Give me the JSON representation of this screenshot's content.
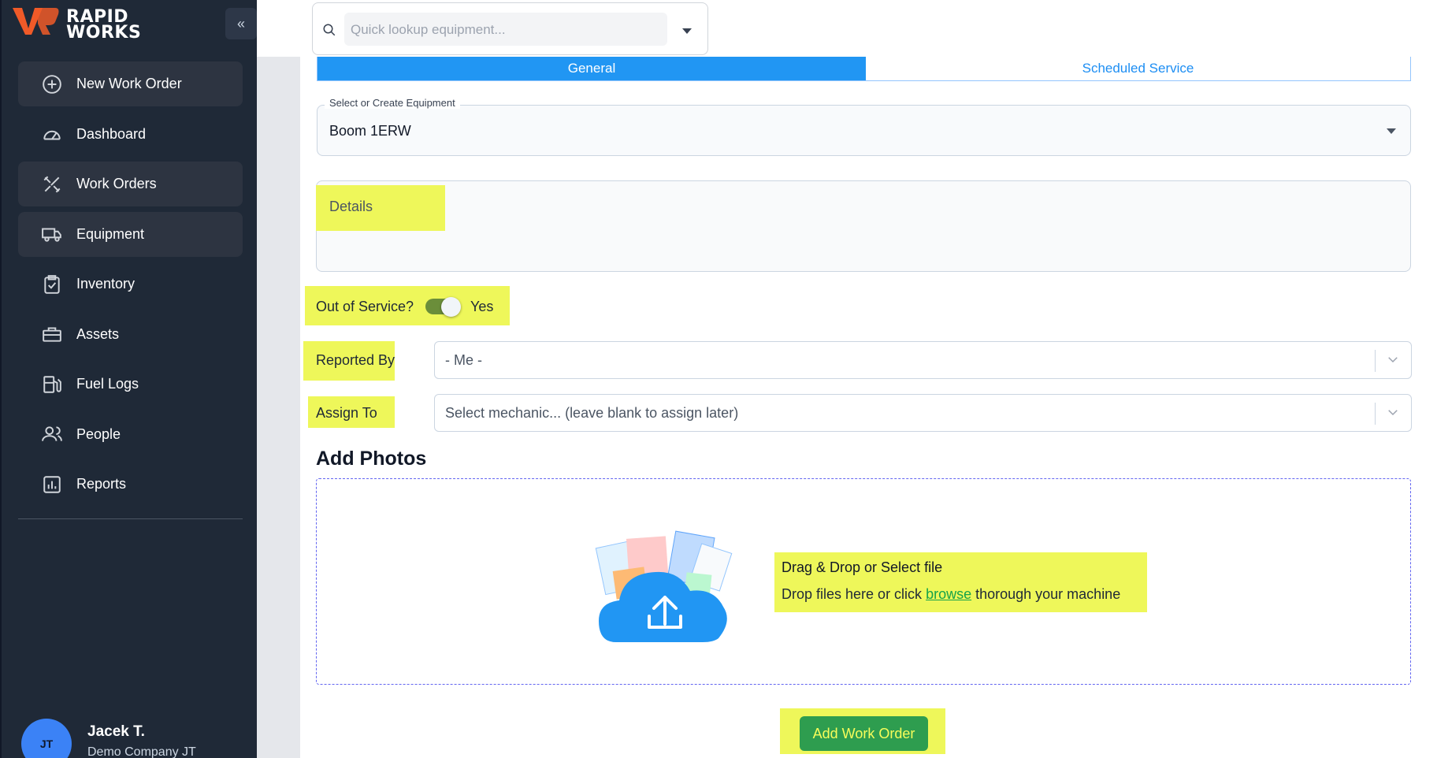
{
  "brand": {
    "line1": "RAPID",
    "line2": "WORKS",
    "accent": "#f05a28"
  },
  "sidebar": {
    "collapse_glyph": "«",
    "items": [
      {
        "label": "New Work Order",
        "icon": "plus-circle-icon",
        "active": true
      },
      {
        "label": "Dashboard",
        "icon": "gauge-icon",
        "active": false
      },
      {
        "label": "Work Orders",
        "icon": "tools-icon",
        "active": true
      },
      {
        "label": "Equipment",
        "icon": "truck-icon",
        "active": true
      },
      {
        "label": "Inventory",
        "icon": "clipboard-check-icon",
        "active": false
      },
      {
        "label": "Assets",
        "icon": "toolbox-icon",
        "active": false
      },
      {
        "label": "Fuel Logs",
        "icon": "fuel-pump-icon",
        "active": false
      },
      {
        "label": "People",
        "icon": "people-icon",
        "active": false
      },
      {
        "label": "Reports",
        "icon": "bar-chart-icon",
        "active": false
      }
    ],
    "user": {
      "initials": "JT",
      "name": "Jacek T.",
      "company": "Demo Company JT"
    }
  },
  "lookup": {
    "placeholder": "Quick lookup equipment..."
  },
  "tabs": [
    {
      "label": "General",
      "active": true
    },
    {
      "label": "Scheduled Service",
      "active": false
    }
  ],
  "form": {
    "equipment_label": "Select or Create Equipment",
    "equipment_value": "Boom 1ERW",
    "details_placeholder": "Details",
    "out_of_service_label": "Out of Service?",
    "out_of_service_value": "Yes",
    "reported_by_label": "Reported By",
    "reported_by_value": "- Me -",
    "assign_to_label": "Assign To",
    "assign_to_placeholder": "Select mechanic... (leave blank to assign later)",
    "photos_title": "Add Photos",
    "drop_title": "Drag & Drop or Select file",
    "drop_sub_before": "Drop files here or click ",
    "drop_sub_link": "browse",
    "drop_sub_after": " thorough your machine",
    "submit_label": "Add Work Order"
  },
  "colors": {
    "highlight": "#eef75a",
    "tab_active": "#2196f3",
    "submit": "#2e9d4f",
    "sidebar": "#1f2937"
  }
}
